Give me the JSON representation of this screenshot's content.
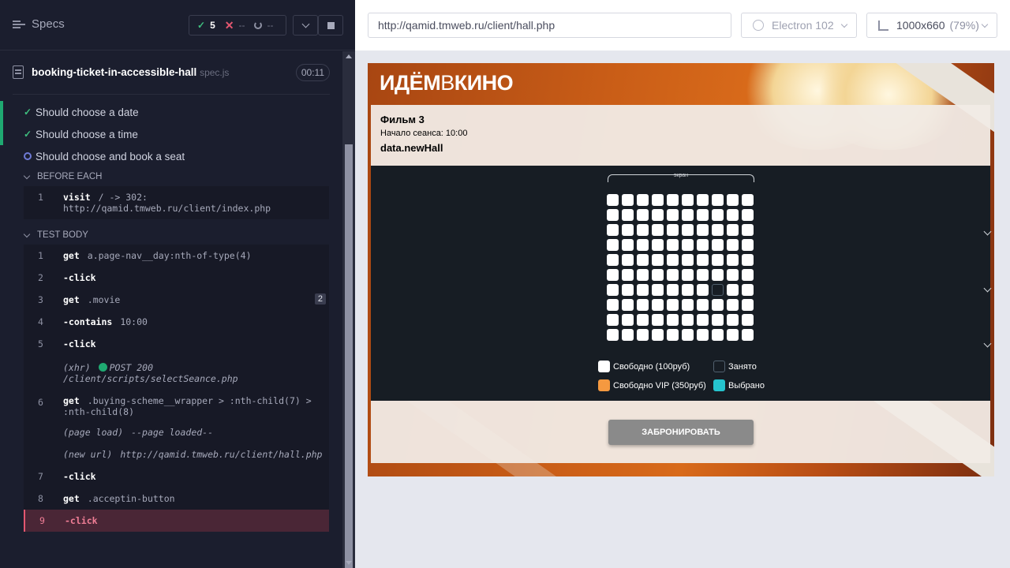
{
  "runner": {
    "specs_label": "Specs",
    "stats": {
      "passed": "5",
      "failed": "--",
      "pending": "--"
    },
    "spec": {
      "name": "booking-ticket-in-accessible-hall",
      "ext": "spec.js",
      "duration": "00:11"
    },
    "tests": [
      {
        "title": "Should choose a date",
        "state": "passed"
      },
      {
        "title": "Should choose a time",
        "state": "passed"
      },
      {
        "title": "Should choose and book a seat",
        "state": "running"
      }
    ],
    "before_each": {
      "title": "BEFORE EACH",
      "commands": [
        {
          "num": "1",
          "name": "visit",
          "msg": "/ -> 302:",
          "msg2": "http://qamid.tmweb.ru/client/index.php"
        }
      ]
    },
    "test_body": {
      "title": "TEST BODY",
      "commands": [
        {
          "num": "1",
          "name": "get",
          "msg": "a.page-nav__day:nth-of-type(4)"
        },
        {
          "num": "2",
          "name": "-click",
          "msg": ""
        },
        {
          "num": "3",
          "name": "get",
          "msg": ".movie",
          "badge": "2"
        },
        {
          "num": "4",
          "name": "-contains",
          "msg": "10:00"
        },
        {
          "num": "5",
          "name": "-click",
          "msg": ""
        },
        {
          "num": "",
          "name": "(xhr)",
          "msg": "POST 200",
          "msg2": "/client/scripts/selectSeance.php"
        },
        {
          "num": "6",
          "name": "get",
          "msg": ".buying-scheme__wrapper > :nth-child(7) >",
          "msg2": ":nth-child(8)"
        },
        {
          "num": "",
          "name": "(page load)",
          "msg": "--page loaded--"
        },
        {
          "num": "",
          "name": "(new url)",
          "msg": "http://qamid.tmweb.ru/client/hall.php"
        },
        {
          "num": "7",
          "name": "-click",
          "msg": ""
        },
        {
          "num": "8",
          "name": "get",
          "msg": ".acceptin-button"
        },
        {
          "num": "9",
          "name": "-click",
          "msg": ""
        }
      ]
    }
  },
  "aut": {
    "url": "http://qamid.tmweb.ru/client/hall.php",
    "browser": "Electron 102",
    "viewport": "1000x660",
    "zoom": "(79%)"
  },
  "app": {
    "logo_a": "ИДЁМ",
    "logo_b": "В",
    "logo_c": "КИНО",
    "movie_title": "Фильм 3",
    "movie_start": "Начало сеанса: 10:00",
    "hall_name": "data.newHall",
    "screen_label": "экран",
    "rows": 10,
    "seats_per_row": 10,
    "taken_seat": {
      "row": 7,
      "seat": 8
    },
    "legend": {
      "free": "Свободно (100руб)",
      "vip": "Свободно VIP (350руб)",
      "taken": "Занято",
      "selected": "Выбрано"
    },
    "colors": {
      "vip": "#f59940",
      "selected": "#25c4ce",
      "free": "#ffffff"
    },
    "book_button": "ЗАБРОНИРОВАТЬ"
  }
}
